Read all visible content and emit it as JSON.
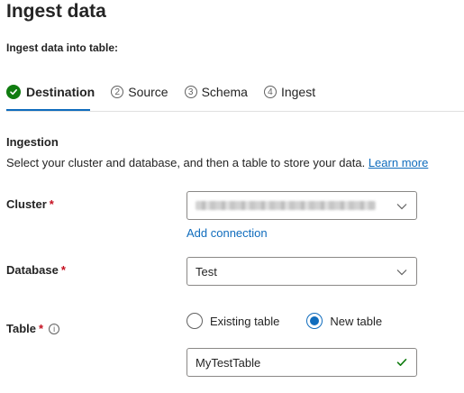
{
  "page": {
    "title": "Ingest data",
    "subtitle": "Ingest data into table:"
  },
  "tabs": [
    {
      "label": "Destination",
      "number": "",
      "state": "completed-active"
    },
    {
      "label": "Source",
      "number": "2",
      "state": "pending"
    },
    {
      "label": "Schema",
      "number": "3",
      "state": "pending"
    },
    {
      "label": "Ingest",
      "number": "4",
      "state": "pending"
    }
  ],
  "ingestion": {
    "heading": "Ingestion",
    "description": "Select your cluster and database, and then a table to store your data.",
    "learn_more": "Learn more"
  },
  "cluster": {
    "label": "Cluster",
    "required_mark": "*",
    "value": "",
    "value_obscured": true,
    "add_connection": "Add connection"
  },
  "database": {
    "label": "Database",
    "required_mark": "*",
    "value": "Test"
  },
  "table": {
    "label": "Table",
    "required_mark": "*",
    "info_glyph": "i",
    "options": [
      "Existing table",
      "New table"
    ],
    "selected": "New table",
    "input_value": "MyTestTable",
    "valid": true
  },
  "colors": {
    "accent": "#0f6cbd",
    "success": "#107c10",
    "required": "#c50f1f"
  }
}
